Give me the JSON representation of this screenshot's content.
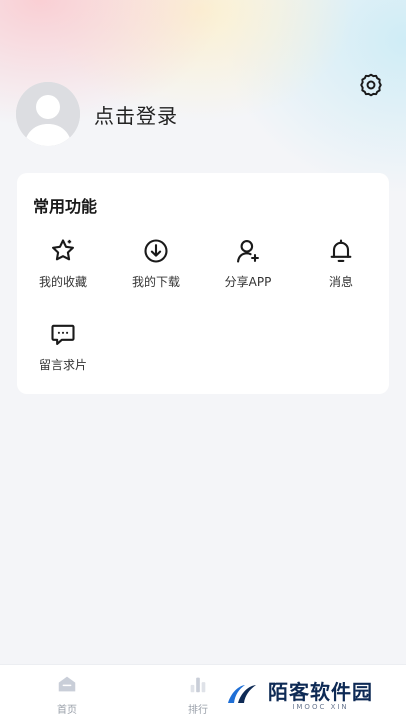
{
  "profile": {
    "login_label": "点击登录"
  },
  "features": {
    "title": "常用功能",
    "items": [
      {
        "label": "我的收藏",
        "icon": "star-icon"
      },
      {
        "label": "我的下载",
        "icon": "download-icon"
      },
      {
        "label": "分享APP",
        "icon": "share-user-icon"
      },
      {
        "label": "消息",
        "icon": "bell-icon"
      },
      {
        "label": "留言求片",
        "icon": "message-icon"
      }
    ]
  },
  "tabbar": {
    "items": [
      {
        "label": "首页",
        "icon": "home-icon"
      },
      {
        "label": "排行",
        "icon": "ranking-icon"
      }
    ]
  },
  "watermark": {
    "title": "陌客软件园",
    "subtitle": "IMOOC XIN"
  },
  "colors": {
    "background": "#f4f5f8",
    "card": "#ffffff",
    "icon": "#1a1a1a",
    "tab_inactive": "#9aa0aa",
    "watermark": "#0e2a55"
  }
}
